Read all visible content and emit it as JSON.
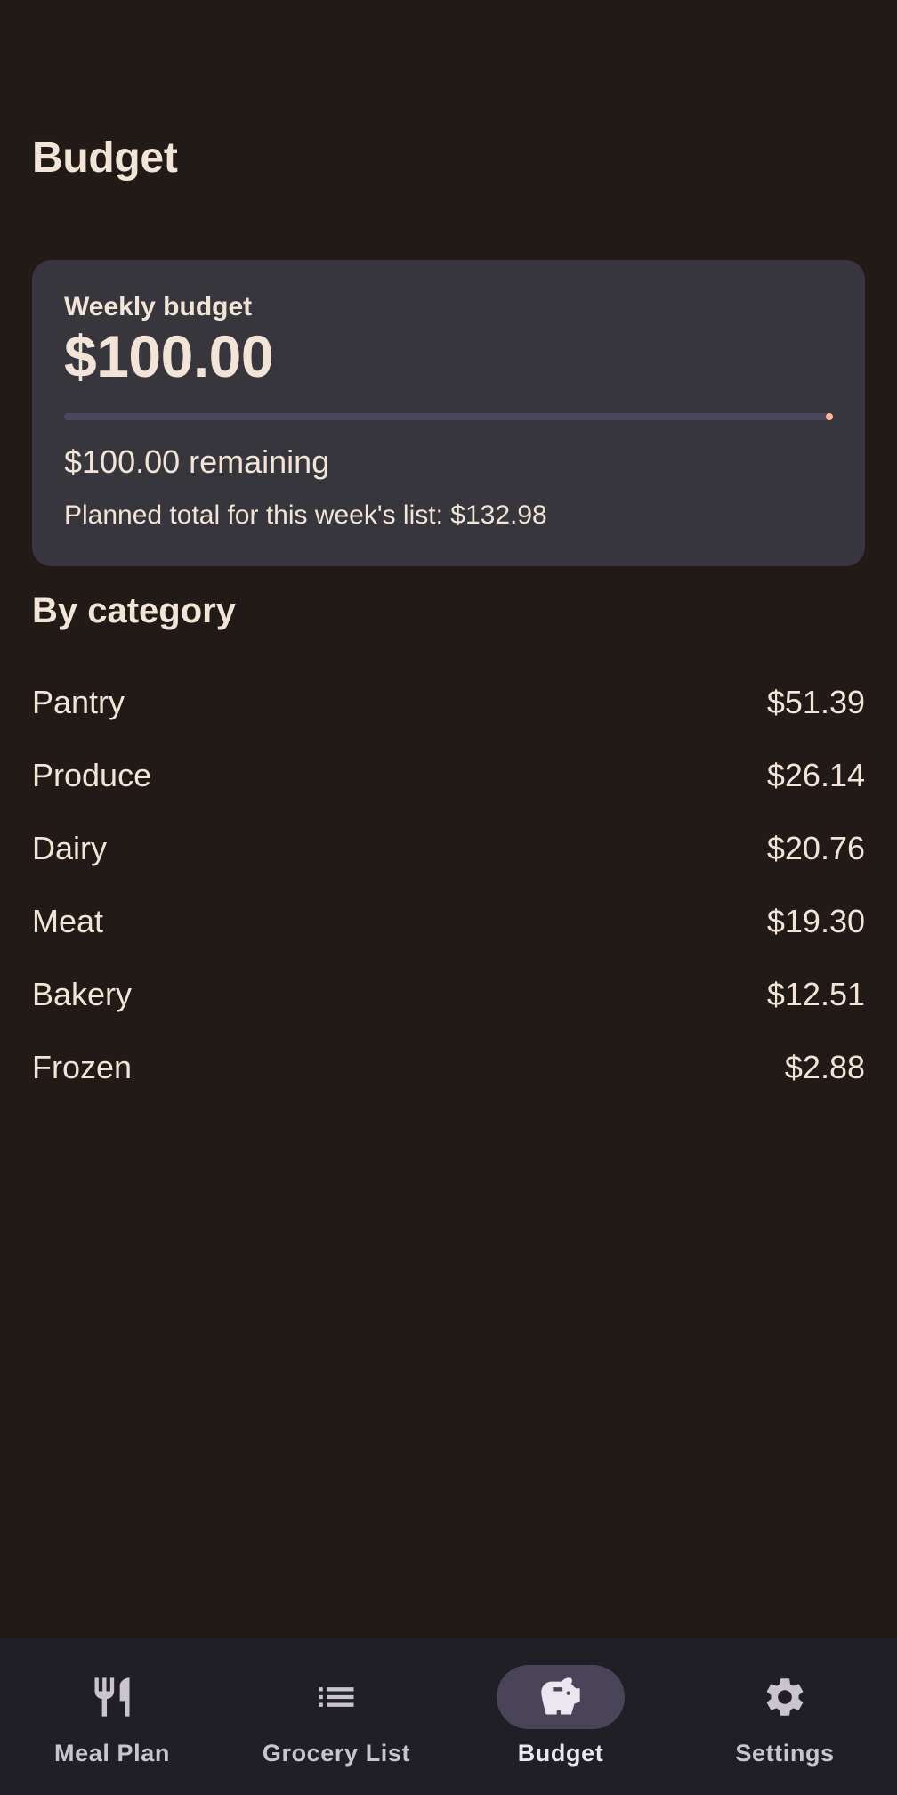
{
  "header": {
    "title": "Budget"
  },
  "budget_card": {
    "label": "Weekly budget",
    "amount": "$100.00",
    "progress_fraction": 1.0,
    "remaining_text": "$100.00 remaining",
    "planned_text": "Planned total for this week's list: $132.98"
  },
  "categories": {
    "heading": "By category",
    "items": [
      {
        "name": "Pantry",
        "amount": "$51.39"
      },
      {
        "name": "Produce",
        "amount": "$26.14"
      },
      {
        "name": "Dairy",
        "amount": "$20.76"
      },
      {
        "name": "Meat",
        "amount": "$19.30"
      },
      {
        "name": "Bakery",
        "amount": "$12.51"
      },
      {
        "name": "Frozen",
        "amount": "$2.88"
      }
    ]
  },
  "bottom_nav": {
    "items": [
      {
        "label": "Meal Plan",
        "icon": "utensils-icon",
        "active": false
      },
      {
        "label": "Grocery List",
        "icon": "list-icon",
        "active": false
      },
      {
        "label": "Budget",
        "icon": "piggy-bank-icon",
        "active": true
      },
      {
        "label": "Settings",
        "icon": "gear-icon",
        "active": false
      }
    ]
  },
  "colors": {
    "background": "#221a16",
    "card": "#37363d",
    "accent": "#ffb599",
    "nav_background": "#1f1f25",
    "nav_active_indicator": "#4a4458"
  }
}
